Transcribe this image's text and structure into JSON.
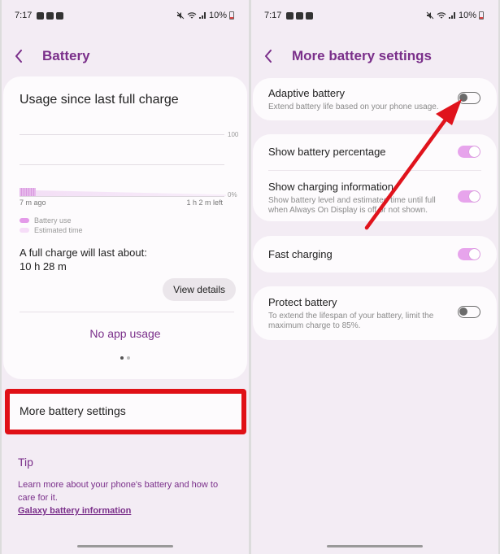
{
  "colors": {
    "accent": "#7a2f8a",
    "toggle_on": "#e7a4ec",
    "highlight": "#e01016",
    "arrow": "#e0131c"
  },
  "left": {
    "status": {
      "time": "7:17",
      "battery": "10%"
    },
    "header": {
      "title": "Battery"
    },
    "usage": {
      "title": "Usage since last full charge",
      "axis_top": "100",
      "axis_bottom": "0%",
      "x_start": "7 m ago",
      "x_end": "1 h 2 m left",
      "battery_level_percent": 10,
      "legend": [
        "Battery use",
        "Estimated time"
      ],
      "full_charge_label": "A full charge will last about:",
      "full_charge_value": "10 h 28 m",
      "view_details": "View details",
      "no_usage": "No app usage"
    },
    "more_settings": "More battery settings",
    "tip": {
      "title": "Tip",
      "text": "Learn more about your phone's battery and how to care for it.",
      "link": "Galaxy battery information"
    }
  },
  "right": {
    "status": {
      "time": "7:17",
      "battery": "10%"
    },
    "header": {
      "title": "More battery settings"
    },
    "settings": [
      {
        "title": "Adaptive battery",
        "subtitle": "Extend battery life based on your phone usage.",
        "enabled": false
      },
      {
        "title": "Show battery percentage",
        "subtitle": "",
        "enabled": true
      },
      {
        "title": "Show charging information",
        "subtitle": "Show battery level and estimated time until full when Always On Display is off or not shown.",
        "enabled": true
      },
      {
        "title": "Fast charging",
        "subtitle": "",
        "enabled": true
      },
      {
        "title": "Protect battery",
        "subtitle": "To extend the lifespan of your battery, limit the maximum charge to 85%.",
        "enabled": false
      }
    ]
  }
}
